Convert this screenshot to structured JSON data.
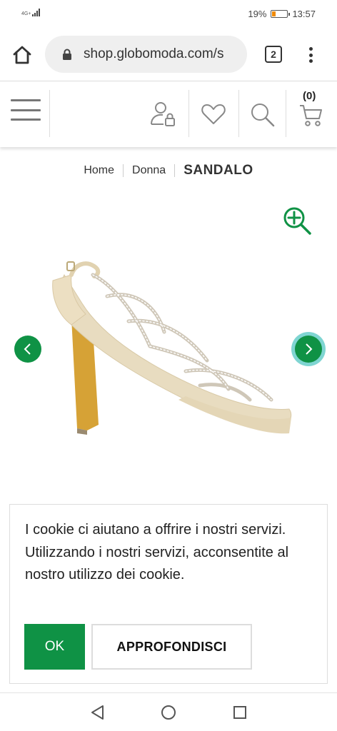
{
  "status_bar": {
    "network": "4G+",
    "battery_percent": "19%",
    "battery_level": 0.19,
    "time": "13:57"
  },
  "browser": {
    "url": "shop.globomoda.com/s",
    "tab_count": "2"
  },
  "header": {
    "cart_count": "(0)"
  },
  "breadcrumb": {
    "items": [
      "Home",
      "Donna"
    ],
    "current": "SANDALO"
  },
  "cookie": {
    "text": "I cookie ci aiutano a offrire i nostri servizi. Utilizzando i nostri servizi, acconsentite al nostro utilizzo dei cookie.",
    "ok_label": "OK",
    "more_label": "APPROFONDISCI"
  },
  "colors": {
    "brand_green": "#0f9245",
    "focus_ring": "#7fd5d2",
    "battery_orange": "#f08a00"
  },
  "icons": [
    "home-icon",
    "lock-icon",
    "menu-icon",
    "user-lock-icon",
    "heart-icon",
    "search-icon",
    "cart-icon",
    "zoom-in-icon",
    "chevron-left-icon",
    "chevron-right-icon",
    "back-icon",
    "home-circle-icon",
    "recent-apps-icon"
  ]
}
